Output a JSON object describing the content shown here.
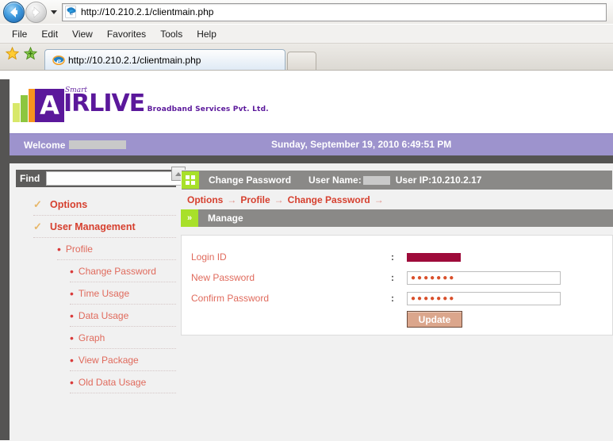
{
  "browser": {
    "address": "http://10.210.2.1/clientmain.php",
    "back_label": "Back",
    "forward_label": "Forward",
    "recent_pages_label": "Recent Pages",
    "menu": [
      "File",
      "Edit",
      "View",
      "Favorites",
      "Tools",
      "Help"
    ],
    "favorites_label": "Favorites Center",
    "add_favorite_label": "Add to Favorites",
    "tab_title": "http://10.210.2.1/clientmain.php",
    "new_tab_label": "New Tab"
  },
  "site": {
    "logo_letter": "A",
    "logo_script": "Smart",
    "logo_word": "IRLIVE",
    "logo_sub": "Broadband Services Pvt. Ltd.",
    "welcome_label": "Welcome",
    "welcome_user_redacted": "",
    "datetime": "Sunday, September 19, 2010 6:49:51 PM"
  },
  "sidebar": {
    "find_label": "Find",
    "find_value": "",
    "find_placeholder": "",
    "scroll_up_label": "Scroll up",
    "items": [
      {
        "label": "Options",
        "level": 0,
        "marker": "check"
      },
      {
        "label": "User Management",
        "level": 0,
        "marker": "check"
      },
      {
        "label": "Profile",
        "level": 1,
        "marker": "bullet"
      },
      {
        "label": "Change Password",
        "level": 2,
        "marker": "bullet"
      },
      {
        "label": "Time Usage",
        "level": 2,
        "marker": "bullet"
      },
      {
        "label": "Data Usage",
        "level": 2,
        "marker": "bullet"
      },
      {
        "label": "Graph",
        "level": 2,
        "marker": "bullet"
      },
      {
        "label": "View Package",
        "level": 2,
        "marker": "bullet"
      },
      {
        "label": "Old Data Usage",
        "level": 2,
        "marker": "bullet"
      }
    ]
  },
  "content": {
    "page_title": "Change Password",
    "user_name_label": "User Name:",
    "user_name_redacted": "",
    "user_ip": "User IP:10.210.2.17",
    "breadcrumb": [
      "Options",
      "Profile",
      "Change Password"
    ],
    "breadcrumb_sep": "→",
    "section_title": "Manage",
    "section_icon": "»",
    "form": {
      "colon": ":",
      "rows": [
        {
          "label": "Login ID",
          "type": "redacted",
          "value": ""
        },
        {
          "label": "New Password",
          "type": "password",
          "value": "●●●●●●●"
        },
        {
          "label": "Confirm Password",
          "type": "password",
          "value": "●●●●●●●"
        }
      ],
      "submit_label": "Update"
    }
  },
  "colors": {
    "accent_purple": "#5b189b",
    "welcome_bar": "#9d93cd",
    "header_gray": "#8a8987",
    "icon_green": "#a8e02a",
    "link_red": "#d6402f",
    "button_tan": "#dba68c",
    "redact_crimson": "#9e0b3a"
  }
}
